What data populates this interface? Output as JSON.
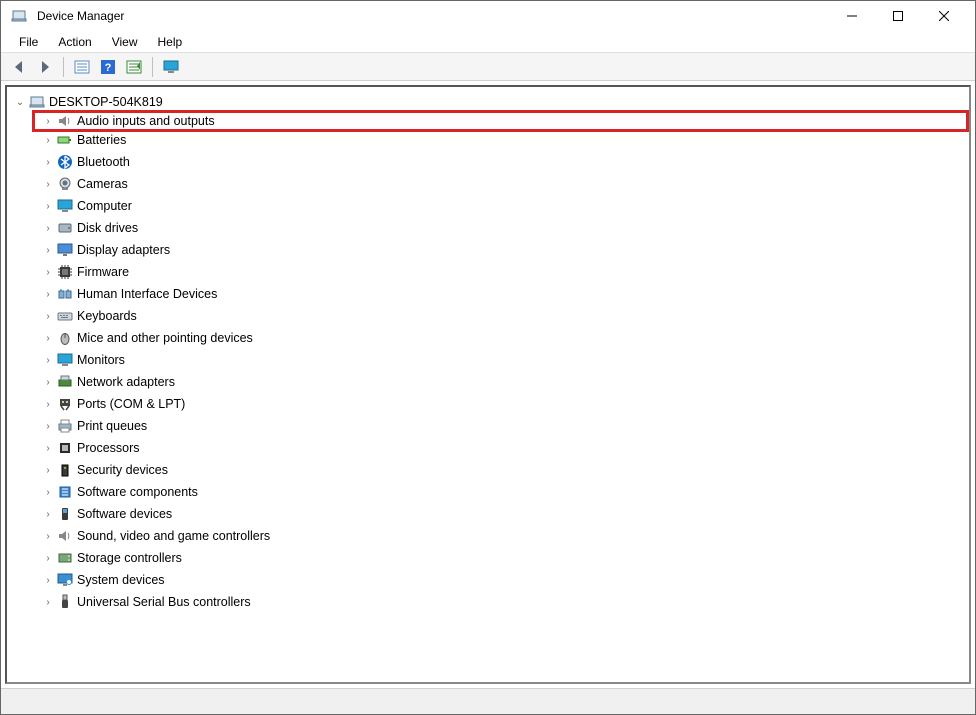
{
  "window": {
    "title": "Device Manager"
  },
  "menus": [
    "File",
    "Action",
    "View",
    "Help"
  ],
  "toolbar": [
    {
      "name": "back-button",
      "icon": "arrow-left"
    },
    {
      "name": "forward-button",
      "icon": "arrow-right"
    },
    {
      "name": "sep"
    },
    {
      "name": "details-button",
      "icon": "list"
    },
    {
      "name": "help-button",
      "icon": "question"
    },
    {
      "name": "scan-button",
      "icon": "scan"
    },
    {
      "name": "sep"
    },
    {
      "name": "monitor-button",
      "icon": "monitor"
    }
  ],
  "tree": {
    "root": {
      "label": "DESKTOP-504K819",
      "icon": "computer",
      "expanded": true
    },
    "children": [
      {
        "label": "Audio inputs and outputs",
        "icon": "speaker",
        "highlighted": true
      },
      {
        "label": "Batteries",
        "icon": "battery"
      },
      {
        "label": "Bluetooth",
        "icon": "bluetooth"
      },
      {
        "label": "Cameras",
        "icon": "camera"
      },
      {
        "label": "Computer",
        "icon": "monitor"
      },
      {
        "label": "Disk drives",
        "icon": "disk"
      },
      {
        "label": "Display adapters",
        "icon": "display"
      },
      {
        "label": "Firmware",
        "icon": "chip"
      },
      {
        "label": "Human Interface Devices",
        "icon": "hid"
      },
      {
        "label": "Keyboards",
        "icon": "keyboard"
      },
      {
        "label": "Mice and other pointing devices",
        "icon": "mouse"
      },
      {
        "label": "Monitors",
        "icon": "monitor"
      },
      {
        "label": "Network adapters",
        "icon": "network"
      },
      {
        "label": "Ports (COM & LPT)",
        "icon": "port"
      },
      {
        "label": "Print queues",
        "icon": "printer"
      },
      {
        "label": "Processors",
        "icon": "cpu"
      },
      {
        "label": "Security devices",
        "icon": "security"
      },
      {
        "label": "Software components",
        "icon": "component"
      },
      {
        "label": "Software devices",
        "icon": "softdev"
      },
      {
        "label": "Sound, video and game controllers",
        "icon": "speaker"
      },
      {
        "label": "Storage controllers",
        "icon": "storage"
      },
      {
        "label": "System devices",
        "icon": "system"
      },
      {
        "label": "Universal Serial Bus controllers",
        "icon": "usb"
      }
    ]
  }
}
